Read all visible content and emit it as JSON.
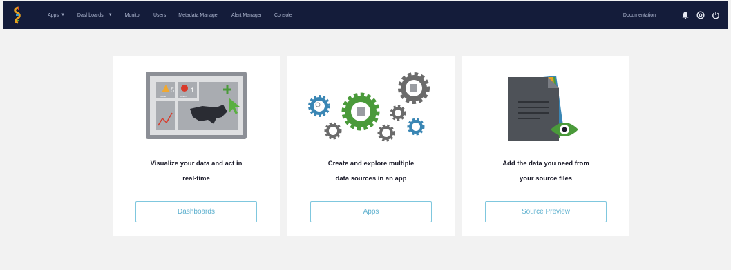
{
  "nav": {
    "items": [
      {
        "label": "Apps",
        "dropdown": true
      },
      {
        "label": "Dashboards",
        "dropdown": true
      },
      {
        "label": "Monitor",
        "dropdown": false
      },
      {
        "label": "Users",
        "dropdown": false
      },
      {
        "label": "Metadata Manager",
        "dropdown": false
      },
      {
        "label": "Alert Manager",
        "dropdown": false
      },
      {
        "label": "Console",
        "dropdown": false
      }
    ],
    "documentation": "Documentation",
    "icons": [
      "bell-icon",
      "help-icon",
      "power-icon"
    ]
  },
  "cards": [
    {
      "line1": "Visualize your data and act in",
      "line2": "real-time",
      "button": "Dashboards",
      "illustration": {
        "warning_count": "5",
        "alert_count": "1",
        "warning_caption": "ISSUE",
        "alert_caption": "ALERT"
      }
    },
    {
      "line1": "Create and explore multiple",
      "line2": "data sources in an app",
      "button": "Apps"
    },
    {
      "line1": "Add the data you need from",
      "line2": "your source files",
      "button": "Source Preview"
    }
  ],
  "colors": {
    "topbar": "#141c3a",
    "background": "#f2f2f2",
    "button_border": "#7fc7de",
    "button_text": "#5fb1cf",
    "gear_green": "#4a9a3a",
    "gear_blue": "#3a86b4",
    "gear_gray": "#6b6b6b"
  }
}
